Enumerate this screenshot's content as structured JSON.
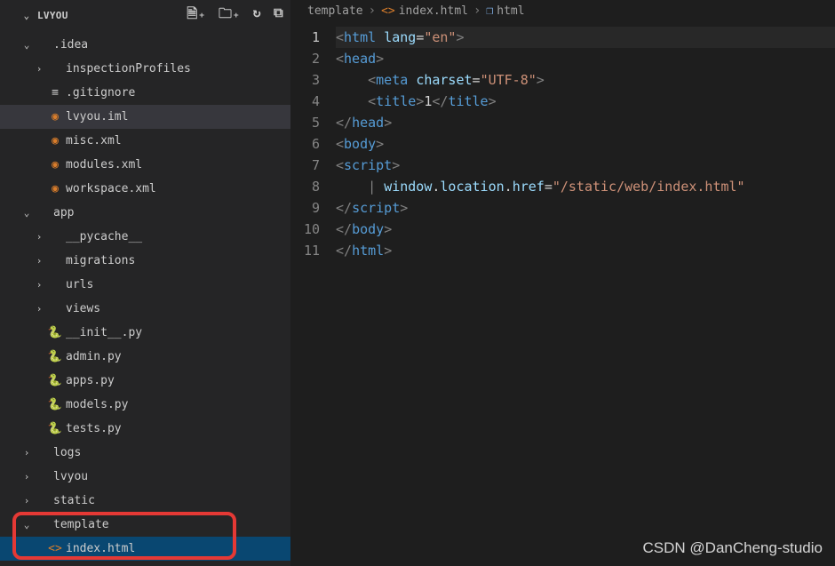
{
  "sidebar": {
    "project_name": "LVYOU",
    "tree": [
      {
        "indent": 0,
        "kind": "folder",
        "open": true,
        "label": ".idea"
      },
      {
        "indent": 1,
        "kind": "folder",
        "open": false,
        "label": "inspectionProfiles"
      },
      {
        "indent": 1,
        "kind": "file",
        "icon": "git",
        "label": ".gitignore"
      },
      {
        "indent": 1,
        "kind": "file",
        "icon": "rss",
        "label": "lvyou.iml",
        "selected": true
      },
      {
        "indent": 1,
        "kind": "file",
        "icon": "rss",
        "label": "misc.xml"
      },
      {
        "indent": 1,
        "kind": "file",
        "icon": "rss",
        "label": "modules.xml"
      },
      {
        "indent": 1,
        "kind": "file",
        "icon": "rss",
        "label": "workspace.xml"
      },
      {
        "indent": 0,
        "kind": "folder",
        "open": true,
        "label": "app"
      },
      {
        "indent": 1,
        "kind": "folder",
        "open": false,
        "label": "__pycache__"
      },
      {
        "indent": 1,
        "kind": "folder",
        "open": false,
        "label": "migrations"
      },
      {
        "indent": 1,
        "kind": "folder",
        "open": false,
        "label": "urls"
      },
      {
        "indent": 1,
        "kind": "folder",
        "open": false,
        "label": "views"
      },
      {
        "indent": 1,
        "kind": "file",
        "icon": "py",
        "label": "__init__.py"
      },
      {
        "indent": 1,
        "kind": "file",
        "icon": "py",
        "label": "admin.py"
      },
      {
        "indent": 1,
        "kind": "file",
        "icon": "py",
        "label": "apps.py"
      },
      {
        "indent": 1,
        "kind": "file",
        "icon": "py",
        "label": "models.py"
      },
      {
        "indent": 1,
        "kind": "file",
        "icon": "py",
        "label": "tests.py"
      },
      {
        "indent": 0,
        "kind": "folder",
        "open": false,
        "label": "logs"
      },
      {
        "indent": 0,
        "kind": "folder",
        "open": false,
        "label": "lvyou"
      },
      {
        "indent": 0,
        "kind": "folder",
        "open": false,
        "label": "static"
      },
      {
        "indent": 0,
        "kind": "folder",
        "open": true,
        "label": "template"
      },
      {
        "indent": 1,
        "kind": "file",
        "icon": "html",
        "label": "index.html",
        "active": true
      }
    ]
  },
  "breadcrumbs": {
    "part1": "template",
    "part2": "index.html",
    "part3": "html"
  },
  "code": {
    "lines": [
      "1",
      "2",
      "3",
      "4",
      "5",
      "6",
      "7",
      "8",
      "9",
      "10",
      "11"
    ],
    "active_line": 1,
    "rows": [
      {
        "i": 0,
        "html": "<span class='t-gray'>&lt;</span><span class='t-tag'>html</span> <span class='t-attr'>lang</span><span class='t-punct'>=</span><span class='t-str'>\"en\"</span><span class='t-gray'>&gt;</span>"
      },
      {
        "i": 0,
        "html": "<span class='t-gray'>&lt;</span><span class='t-tag'>head</span><span class='t-gray'>&gt;</span>"
      },
      {
        "i": 1,
        "html": "<span class='t-gray'>&lt;</span><span class='t-tag'>meta</span> <span class='t-attr'>charset</span><span class='t-punct'>=</span><span class='t-str'>\"UTF-8\"</span><span class='t-gray'>&gt;</span>"
      },
      {
        "i": 1,
        "html": "<span class='t-gray'>&lt;</span><span class='t-tag'>title</span><span class='t-gray'>&gt;</span><span class='t-text'>1</span><span class='t-gray'>&lt;/</span><span class='t-tag'>title</span><span class='t-gray'>&gt;</span>"
      },
      {
        "i": 0,
        "html": "<span class='t-gray'>&lt;/</span><span class='t-tag'>head</span><span class='t-gray'>&gt;</span>"
      },
      {
        "i": 0,
        "html": "<span class='t-gray'>&lt;</span><span class='t-tag'>body</span><span class='t-gray'>&gt;</span>"
      },
      {
        "i": 0,
        "html": "<span class='t-gray'>&lt;</span><span class='t-tag'>script</span><span class='t-gray'>&gt;</span>"
      },
      {
        "i": 1,
        "html": "<span class='t-gray'>|</span> <span class='t-attr'>window</span><span class='t-punct'>.</span><span class='t-attr'>location</span><span class='t-punct'>.</span><span class='t-attr'>href</span><span class='t-punct'>=</span><span class='t-str'>\"/static/web/index.html\"</span>"
      },
      {
        "i": 0,
        "html": "<span class='t-gray'>&lt;/</span><span class='t-tag'>script</span><span class='t-gray'>&gt;</span>"
      },
      {
        "i": 0,
        "html": "<span class='t-gray'>&lt;/</span><span class='t-tag'>body</span><span class='t-gray'>&gt;</span>"
      },
      {
        "i": 0,
        "html": "<span class='t-gray'>&lt;/</span><span class='t-tag'>html</span><span class='t-gray'>&gt;</span>"
      }
    ]
  },
  "watermark": "CSDN @DanCheng-studio"
}
